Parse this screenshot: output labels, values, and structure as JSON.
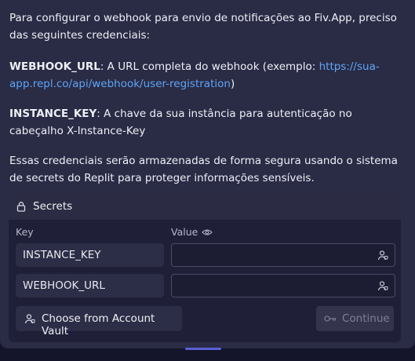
{
  "message": {
    "intro": "Para configurar o webhook para envio de notificações ao Fiv.App, preciso das seguintes credenciais:",
    "webhook_label": "WEBHOOK_URL",
    "webhook_desc": ": A URL completa do webhook (exemplo: ",
    "webhook_example": "https://sua-app.repl.co/api/webhook/user-registration",
    "webhook_close": ")",
    "instance_label": "INSTANCE_KEY",
    "instance_desc": ": A chave da sua instância para autenticação no cabeçalho X-Instance-Key",
    "closing": "Essas credenciais serão armazenadas de forma segura usando o sistema de secrets do Replit para proteger informações sensíveis."
  },
  "secrets": {
    "title": "Secrets",
    "key_header": "Key",
    "value_header": "Value",
    "rows": [
      {
        "key": "INSTANCE_KEY",
        "value": ""
      },
      {
        "key": "WEBHOOK_URL",
        "value": ""
      }
    ],
    "vault_button": "Choose from Account Vault",
    "continue_button": "Continue"
  },
  "icons": {
    "lock": "lock-icon",
    "eye": "eye-icon",
    "user": "user-icon",
    "key": "key-icon"
  },
  "colors": {
    "panel_bg": "#2a2b45",
    "link": "#5ea6f5",
    "accent": "#5c5fd6"
  }
}
